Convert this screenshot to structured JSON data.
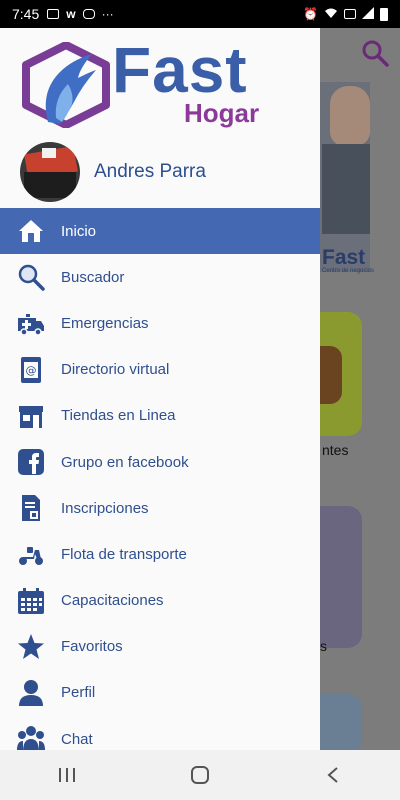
{
  "status_bar": {
    "time": "7:45",
    "more": "···"
  },
  "logo": {
    "word1": "Fast",
    "word2": "Hogar",
    "colors": {
      "primary": "#3a5fa8",
      "secondary": "#8b3a9a"
    }
  },
  "user": {
    "name": "Andres Parra"
  },
  "menu": {
    "items": [
      {
        "label": "Inicio",
        "icon": "home-icon",
        "active": true
      },
      {
        "label": "Buscador",
        "icon": "search-icon"
      },
      {
        "label": "Emergencias",
        "icon": "ambulance-icon"
      },
      {
        "label": "Directorio virtual",
        "icon": "address-book-icon"
      },
      {
        "label": "Tiendas en Linea",
        "icon": "store-icon"
      },
      {
        "label": "Grupo en facebook",
        "icon": "facebook-icon"
      },
      {
        "label": "Inscripciones",
        "icon": "form-icon"
      },
      {
        "label": "Flota de transporte",
        "icon": "scooter-icon"
      },
      {
        "label": "Capacitaciones",
        "icon": "calendar-icon"
      },
      {
        "label": "Favoritos",
        "icon": "star-icon"
      },
      {
        "label": "Perfil",
        "icon": "user-icon"
      },
      {
        "label": "Chat",
        "icon": "group-chat-icon"
      }
    ],
    "active_color": "#4469b2"
  },
  "background_app": {
    "banner_brand": "Fast",
    "banner_sub": "Centro de negocios",
    "card1_label": "ntes",
    "card2_label": "s"
  }
}
